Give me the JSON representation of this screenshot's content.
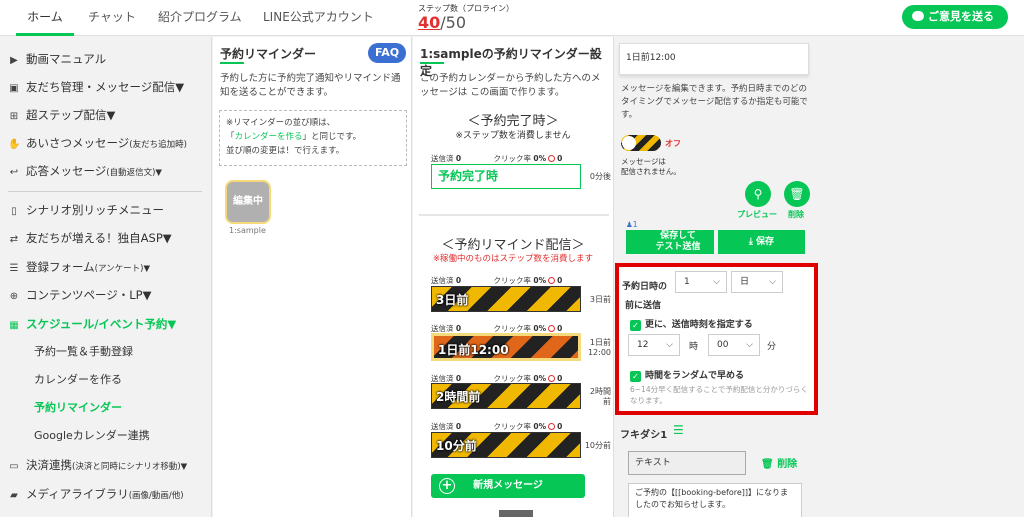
{
  "header": {
    "tabs": [
      "ホーム",
      "チャット",
      "紹介プログラム",
      "LINE公式アカウント"
    ],
    "step_label": "ステップ数（プロライン）",
    "step_current": "40",
    "step_total": "/50",
    "feedback_label": "ご意見を送る"
  },
  "sidebar": {
    "items": [
      {
        "label": "動画マニュアル",
        "icon": "▶"
      },
      {
        "label": "友だち管理・メッセージ配信▼",
        "icon": "▣"
      },
      {
        "label": "超ステップ配信▼",
        "icon": "⊞"
      },
      {
        "label": "あいさつメッセージ",
        "small": "(友だち追加時)",
        "icon": "✋"
      },
      {
        "label": "応答メッセージ",
        "small": "(自動返信文)▼",
        "icon": "↩"
      },
      {
        "label": "シナリオ別リッチメニュー",
        "icon": "▯"
      },
      {
        "label": "友だちが増える！独自ASP▼",
        "icon": "⇄"
      },
      {
        "label": "登録フォーム",
        "small": "(アンケート)▼",
        "icon": "☰"
      },
      {
        "label": "コンテンツページ・LP▼",
        "icon": "⊕"
      },
      {
        "label": "スケジュール/イベント予約▼",
        "icon": "▦"
      },
      {
        "label": "決済連携",
        "small": "(決済と同時にシナリオ移動)▼",
        "icon": "▭"
      },
      {
        "label": "メディアライブラリ",
        "small": "(画像/動画/他)",
        "icon": "▰"
      }
    ],
    "subitems": [
      "予約一覧＆手動登録",
      "カレンダーを作る",
      "予約リマインダー",
      "Googleカレンダー連携"
    ]
  },
  "reminder_panel": {
    "title": "予約リマインダー",
    "faq": "FAQ",
    "description": "予約した方に予約完了通知やリマインド通知を送ることができます。",
    "note_1": "※リマインダーの並び順は、",
    "note_2a": "「",
    "note_2_link": "カレンダーを作る",
    "note_2b": "」と同じです。",
    "note_3": "並び順の変更は！で行えます。",
    "card_label": "編集中",
    "card_caption": "1:sample"
  },
  "settings_panel": {
    "title": "1:sampleの予約リマインダー設定",
    "description": "この予約カレンダーから予約した方へのメッセージは この画面で作ります。",
    "complete_heading": "＜予約完了時＞",
    "complete_note": "※ステップ数を消費しません",
    "complete_box": "予約完了時",
    "complete_timing": "0分後",
    "remind_heading": "＜予約リマインド配信＞",
    "remind_note": "※稼働中のものはステップ数を消費します",
    "sent_label": "送信済",
    "click_label": "クリック率",
    "reminders": [
      {
        "label": "3日前",
        "timing": "3日前",
        "sent": "0",
        "rate": "0",
        "pct": "%",
        "blocked": "0"
      },
      {
        "label": "1日前12:00",
        "timing": "1日前\n12:00",
        "sent": "0",
        "rate": "0",
        "pct": "%",
        "blocked": "0"
      },
      {
        "label": "2時間前",
        "timing": "2時間\n前",
        "sent": "0",
        "rate": "0",
        "pct": "%",
        "blocked": "0"
      },
      {
        "label": "10分前",
        "timing": "10分前",
        "sent": "0",
        "rate": "0",
        "pct": "%",
        "blocked": "0"
      }
    ],
    "complete_stats": {
      "sent": "0",
      "rate": "0",
      "pct": "%",
      "blocked": "0"
    },
    "new_message": "新規メッセージ"
  },
  "editor": {
    "card_title": "1日前12:00",
    "description": "メッセージを編集できます。予約日時までのどのタイミングでメッセージ配信するか指定も可能です。",
    "toggle_label": "オフ",
    "status_1": "メッセージは",
    "status_2": "配信されません。",
    "preview": "プレビュー",
    "delete": "削除",
    "user_count": "1",
    "save_test_1": "保存して",
    "save_test_2": "テスト送信",
    "save": "保存",
    "schedule_label_1": "予約日時の",
    "schedule_label_2": "前に送信",
    "schedule_value": "1",
    "schedule_unit": "日",
    "specify_time": "更に、送信時刻を指定する",
    "hour_value": "12",
    "hour_label": "時",
    "minute_value": "00",
    "minute_label": "分",
    "random_label": "時間をランダムで早める",
    "random_note": "6~14分早く配信することで予約配信と分かりづらくなります。",
    "balloon_title": "フキダシ1",
    "type_value": "テキスト",
    "balloon_delete": "削除",
    "message_text": "ご予約の【[[booking-before]]】になりましたのでお知らせします。"
  },
  "colors": {
    "accent": "#06c755",
    "alert": "#e00000",
    "faq": "#3b6fd1"
  }
}
